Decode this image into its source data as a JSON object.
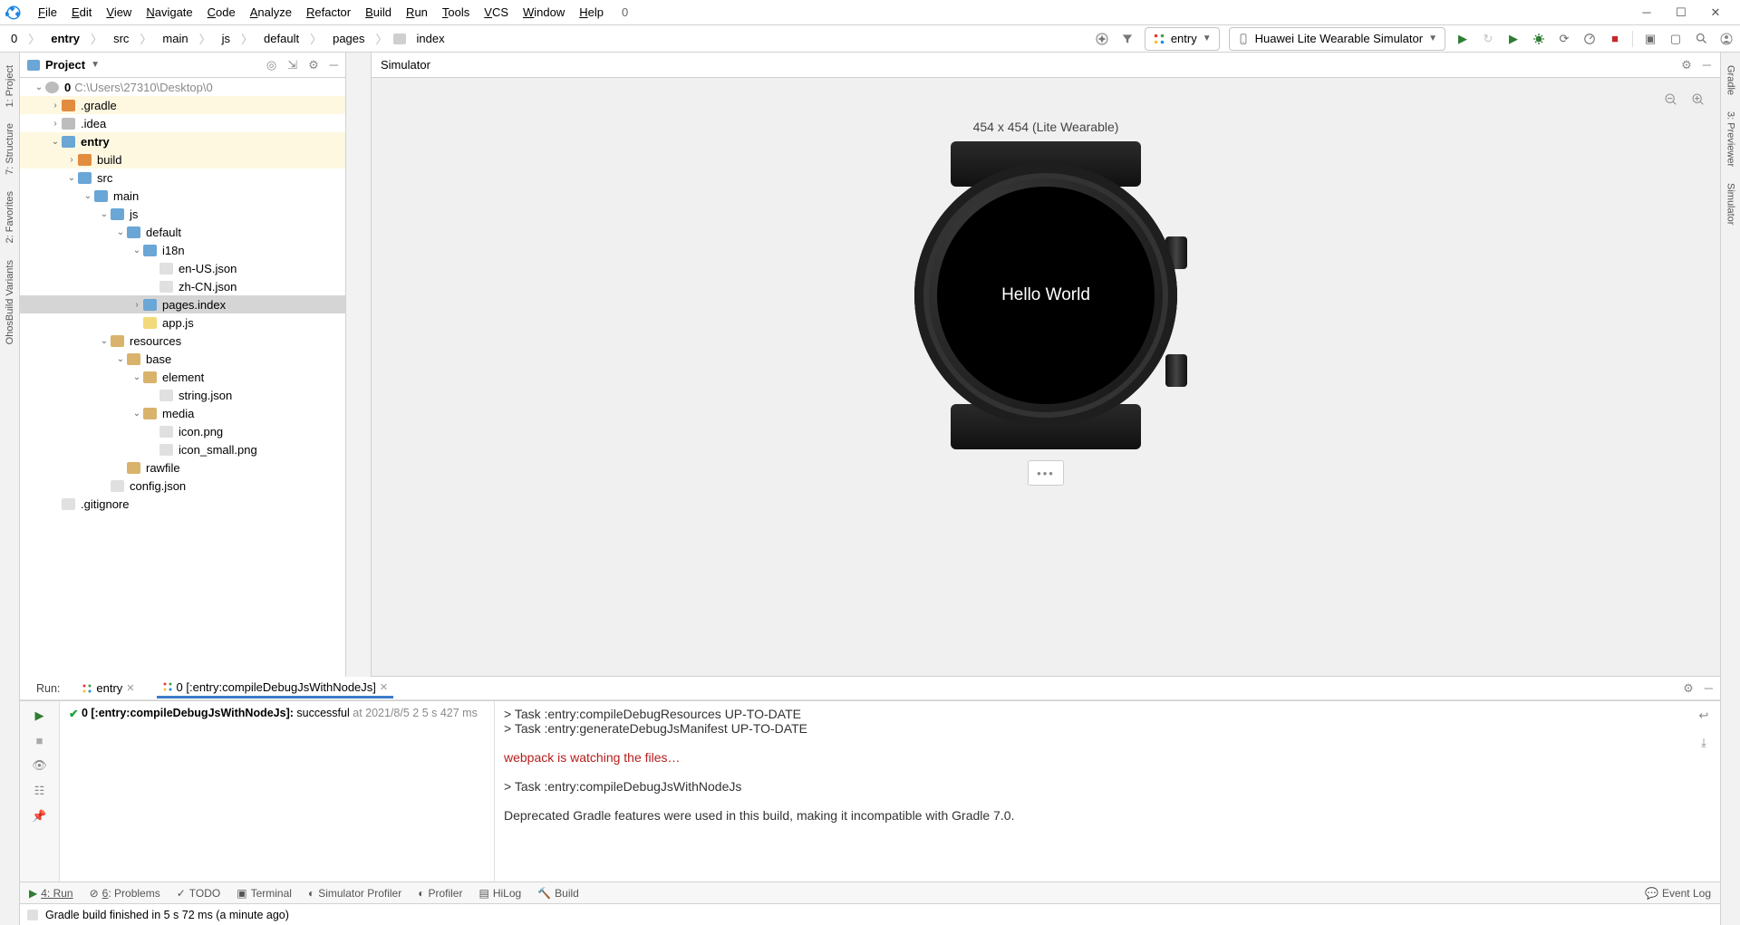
{
  "menus": [
    "File",
    "Edit",
    "View",
    "Navigate",
    "Code",
    "Analyze",
    "Refactor",
    "Build",
    "Run",
    "Tools",
    "VCS",
    "Window",
    "Help"
  ],
  "menu_tail": "0",
  "breadcrumb": [
    "0",
    "entry",
    "src",
    "main",
    "js",
    "default",
    "pages",
    "index"
  ],
  "breadcrumb_bold_index": 1,
  "run_config": {
    "module": "entry",
    "device": "Huawei Lite Wearable Simulator"
  },
  "project_panel": {
    "title": "Project"
  },
  "tree": [
    {
      "d": 0,
      "t": "v",
      "icon": "proj",
      "bold": true,
      "name": "0",
      "suffix": "C:\\Users\\27310\\Desktop\\0",
      "hl": false
    },
    {
      "d": 1,
      "t": ">",
      "icon": "folder-o",
      "name": ".gradle",
      "hl": true
    },
    {
      "d": 1,
      "t": ">",
      "icon": "folder-g",
      "name": ".idea"
    },
    {
      "d": 1,
      "t": "v",
      "icon": "folder-b",
      "bold": true,
      "name": "entry",
      "hl": true
    },
    {
      "d": 2,
      "t": ">",
      "icon": "folder-o",
      "name": "build",
      "hl": true
    },
    {
      "d": 2,
      "t": "v",
      "icon": "folder-b",
      "name": "src"
    },
    {
      "d": 3,
      "t": "v",
      "icon": "folder-b",
      "name": "main"
    },
    {
      "d": 4,
      "t": "v",
      "icon": "folder-b",
      "name": "js"
    },
    {
      "d": 5,
      "t": "v",
      "icon": "folder-b",
      "name": "default"
    },
    {
      "d": 6,
      "t": "v",
      "icon": "folder-b",
      "name": "i18n"
    },
    {
      "d": 7,
      "t": "",
      "icon": "file",
      "name": "en-US.json"
    },
    {
      "d": 7,
      "t": "",
      "icon": "file",
      "name": "zh-CN.json"
    },
    {
      "d": 6,
      "t": ">",
      "icon": "folder-b",
      "name": "pages.index",
      "sel": true
    },
    {
      "d": 6,
      "t": "",
      "icon": "js",
      "name": "app.js"
    },
    {
      "d": 4,
      "t": "v",
      "icon": "folder",
      "name": "resources"
    },
    {
      "d": 5,
      "t": "v",
      "icon": "folder",
      "name": "base"
    },
    {
      "d": 6,
      "t": "v",
      "icon": "folder",
      "name": "element"
    },
    {
      "d": 7,
      "t": "",
      "icon": "file",
      "name": "string.json"
    },
    {
      "d": 6,
      "t": "v",
      "icon": "folder",
      "name": "media"
    },
    {
      "d": 7,
      "t": "",
      "icon": "file",
      "name": "icon.png"
    },
    {
      "d": 7,
      "t": "",
      "icon": "file",
      "name": "icon_small.png"
    },
    {
      "d": 5,
      "t": "",
      "icon": "folder",
      "name": "rawfile"
    },
    {
      "d": 4,
      "t": "",
      "icon": "file",
      "name": "config.json"
    },
    {
      "d": 1,
      "t": "",
      "icon": "file",
      "name": ".gitignore"
    }
  ],
  "simulator": {
    "title": "Simulator",
    "caption": "454 x 454 (Lite Wearable)",
    "display_text": "Hello World"
  },
  "run": {
    "label": "Run:",
    "tabs": [
      {
        "label": "entry"
      },
      {
        "label": "0 [:entry:compileDebugJsWithNodeJs]",
        "active": true
      }
    ],
    "task": {
      "name": "0 [:entry:compileDebugJsWithNodeJs]:",
      "status": "successful",
      "meta": "at 2021/8/5 2 5 s 427 ms"
    },
    "console": [
      {
        "t": "> Task :entry:compileDebugResources UP-TO-DATE"
      },
      {
        "t": "> Task :entry:generateDebugJsManifest UP-TO-DATE"
      },
      {
        "t": ""
      },
      {
        "t": "webpack is watching the files…",
        "cls": "red"
      },
      {
        "t": ""
      },
      {
        "t": "> Task :entry:compileDebugJsWithNodeJs"
      },
      {
        "t": ""
      },
      {
        "t": "Deprecated Gradle features were used in this build, making it incompatible with Gradle 7.0."
      }
    ]
  },
  "tool_tabs": [
    "4: Run",
    "6: Problems",
    "TODO",
    "Terminal",
    "Simulator Profiler",
    "Profiler",
    "HiLog",
    "Build"
  ],
  "event_log": "Event Log",
  "status": "Gradle build finished in 5 s 72 ms (a minute ago)",
  "left_gutter": [
    "1: Project",
    "7: Structure",
    "2: Favorites",
    "OhosBuild Variants"
  ],
  "right_gutter": [
    "Gradle",
    "3: Previewer",
    "Simulator"
  ]
}
